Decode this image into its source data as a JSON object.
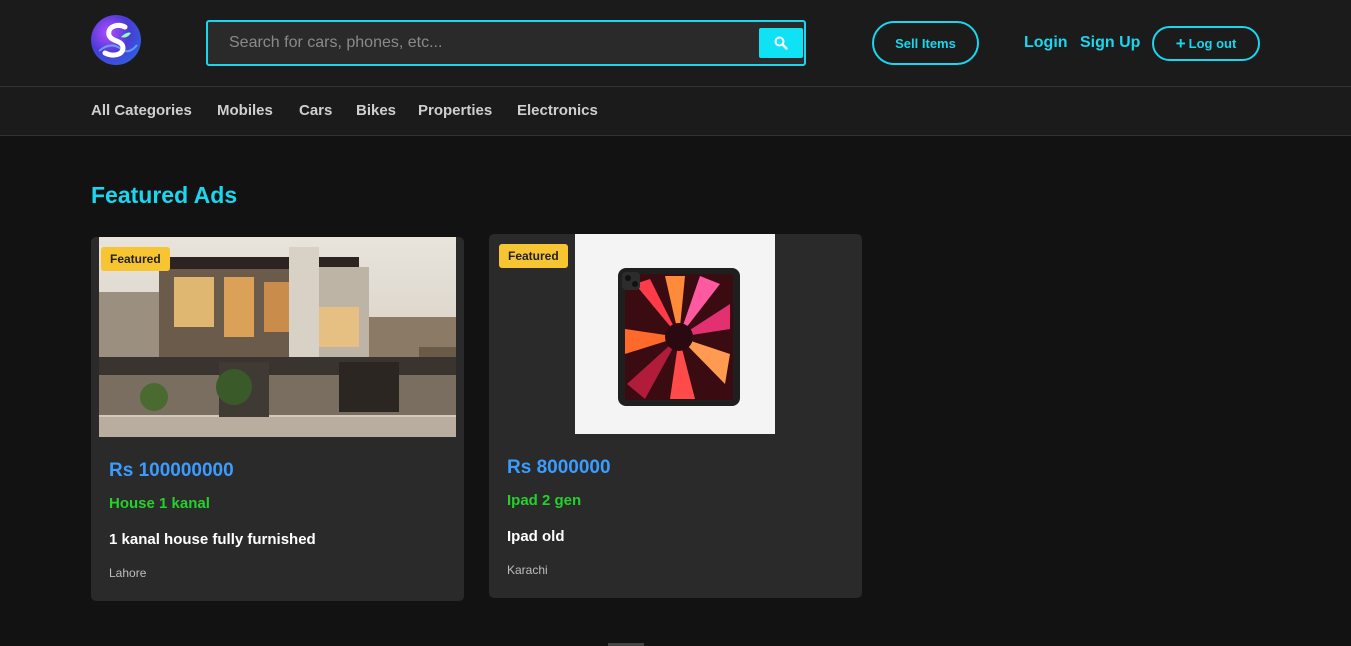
{
  "header": {
    "logo_letter": "S",
    "search_placeholder": "Search for cars, phones, etc...",
    "search_value": "",
    "sell_label": "Sell Items",
    "login_label": "Login",
    "signup_label": "Sign Up",
    "logout_label": "Log out"
  },
  "categories": [
    "All Categories",
    "Mobiles",
    "Cars",
    "Bikes",
    "Properties",
    "Electronics"
  ],
  "section_title": "Featured Ads",
  "ads": [
    {
      "badge": "Featured",
      "price": "Rs 100000000",
      "title": "House 1 kanal",
      "description": "1 kanal house fully furnished",
      "location": "Lahore"
    },
    {
      "badge": "Featured",
      "price": "Rs 8000000",
      "title": "Ipad 2 gen",
      "description": "Ipad old",
      "location": "Karachi"
    }
  ],
  "colors": {
    "accent": "#1ad6ee",
    "price": "#3b9cff",
    "title": "#24d12b",
    "badge": "#f7c531",
    "background": "#121212"
  }
}
